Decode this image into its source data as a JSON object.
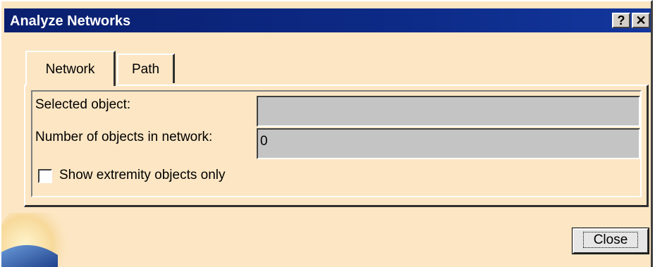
{
  "window": {
    "title": "Analyze Networks",
    "help_label": "?",
    "close_label": "✕"
  },
  "tabs": [
    {
      "label": "Network",
      "active": true
    },
    {
      "label": "Path",
      "active": false
    }
  ],
  "network_tab": {
    "selected_object_label": "Selected object:",
    "selected_object_value": "",
    "number_of_objects_label": "Number of objects in network:",
    "number_of_objects_value": "0",
    "extremity_checkbox_label": "Show extremity objects only",
    "extremity_checkbox_checked": false
  },
  "footer": {
    "close_button_label": "Close"
  },
  "colors": {
    "dialog_background": "#fce6c4",
    "titlebar": "#0a1f6e",
    "field_background": "#c4c4c4"
  }
}
